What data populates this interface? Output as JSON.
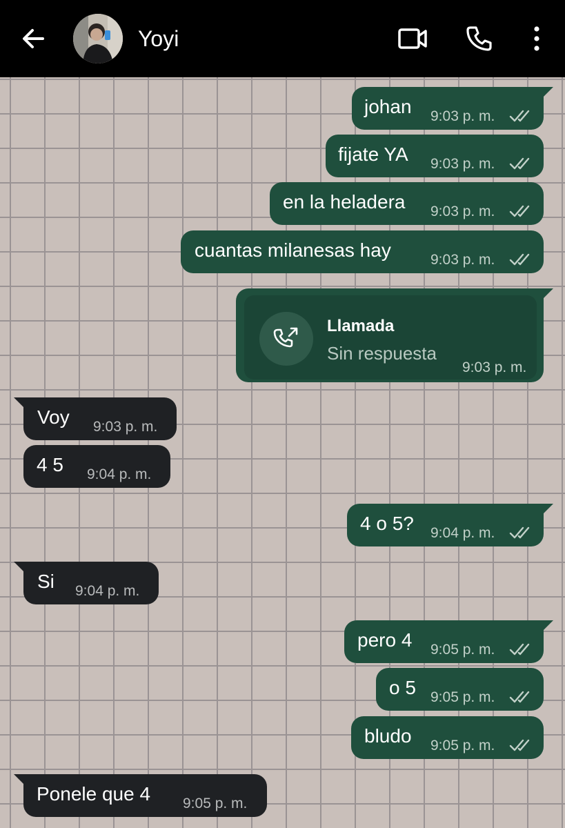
{
  "header": {
    "contact_name": "Yoyi",
    "back_icon": "arrow-left-icon",
    "video_icon": "video-camera-icon",
    "call_icon": "phone-icon",
    "menu_icon": "more-vertical-icon"
  },
  "messages": [
    {
      "direction": "outgoing",
      "text": "johan",
      "time": "9:03 p. m.",
      "status": "read"
    },
    {
      "direction": "outgoing",
      "text": "fijate YA",
      "time": "9:03 p. m.",
      "status": "read"
    },
    {
      "direction": "outgoing",
      "text": "en la heladera",
      "time": "9:03 p. m.",
      "status": "read"
    },
    {
      "direction": "outgoing",
      "text": "cuantas milanesas hay",
      "time": "9:03 p. m.",
      "status": "read"
    },
    {
      "direction": "outgoing",
      "type": "call",
      "title": "Llamada",
      "subtitle": "Sin respuesta",
      "time": "9:03 p. m.",
      "icon": "missed-call-icon"
    },
    {
      "direction": "incoming",
      "text": "Voy",
      "time": "9:03 p. m."
    },
    {
      "direction": "incoming",
      "text": "4 5",
      "time": "9:04 p. m."
    },
    {
      "direction": "outgoing",
      "text": "4 o 5?",
      "time": "9:04 p. m.",
      "status": "read"
    },
    {
      "direction": "incoming",
      "text": "Si",
      "time": "9:04 p. m."
    },
    {
      "direction": "outgoing",
      "text": "pero 4",
      "time": "9:05 p. m.",
      "status": "read"
    },
    {
      "direction": "outgoing",
      "text": "o 5",
      "time": "9:05 p. m.",
      "status": "read"
    },
    {
      "direction": "outgoing",
      "text": "bludo",
      "time": "9:05 p. m.",
      "status": "read"
    },
    {
      "direction": "incoming",
      "text": "Ponele que 4",
      "time": "9:05 p. m."
    }
  ],
  "colors": {
    "header_bg": "#000000",
    "outgoing_bubble": "#1f4f3d",
    "incoming_bubble": "#1f2124",
    "wallpaper": "#c9bfba",
    "grid_lines": "#9a9394",
    "read_ticks": "#c2d1c9"
  }
}
